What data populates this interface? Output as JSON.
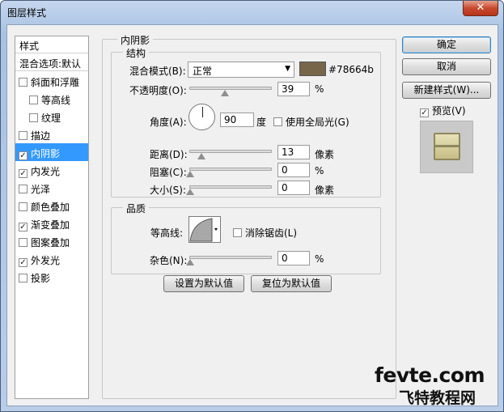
{
  "window": {
    "title": "图层样式",
    "close_label": "✕"
  },
  "styles_list": {
    "header": "样式",
    "blend_default": "混合选项:默认",
    "items": [
      {
        "label": "斜面和浮雕",
        "checked": false,
        "indent": false,
        "selected": false
      },
      {
        "label": "等高线",
        "checked": false,
        "indent": true,
        "selected": false
      },
      {
        "label": "纹理",
        "checked": false,
        "indent": true,
        "selected": false
      },
      {
        "label": "描边",
        "checked": false,
        "indent": false,
        "selected": false
      },
      {
        "label": "内阴影",
        "checked": true,
        "indent": false,
        "selected": true
      },
      {
        "label": "内发光",
        "checked": true,
        "indent": false,
        "selected": false
      },
      {
        "label": "光泽",
        "checked": false,
        "indent": false,
        "selected": false
      },
      {
        "label": "颜色叠加",
        "checked": false,
        "indent": false,
        "selected": false
      },
      {
        "label": "渐变叠加",
        "checked": true,
        "indent": false,
        "selected": false
      },
      {
        "label": "图案叠加",
        "checked": false,
        "indent": false,
        "selected": false
      },
      {
        "label": "外发光",
        "checked": true,
        "indent": false,
        "selected": false
      },
      {
        "label": "投影",
        "checked": false,
        "indent": false,
        "selected": false
      }
    ]
  },
  "panel": {
    "title": "内阴影",
    "structure": {
      "title": "结构",
      "blend_mode_label": "混合模式(B):",
      "blend_mode_value": "正常",
      "color_hex": "#78664b",
      "color": "#78664b",
      "opacity_label": "不透明度(O):",
      "opacity_value": "39",
      "opacity_unit": "%",
      "angle_label": "角度(A):",
      "angle_value": "90",
      "angle_unit": "度",
      "global_light_label": "使用全局光(G)",
      "global_light_checked": false,
      "distance_label": "距离(D):",
      "distance_value": "13",
      "distance_unit": "像素",
      "choke_label": "阻塞(C):",
      "choke_value": "0",
      "choke_unit": "%",
      "size_label": "大小(S):",
      "size_value": "0",
      "size_unit": "像素"
    },
    "quality": {
      "title": "品质",
      "contour_label": "等高线:",
      "antialias_label": "消除锯齿(L)",
      "antialias_checked": false,
      "noise_label": "杂色(N):",
      "noise_value": "0",
      "noise_unit": "%"
    },
    "make_default_label": "设置为默认值",
    "reset_default_label": "复位为默认值"
  },
  "buttons": {
    "ok": "确定",
    "cancel": "取消",
    "new_style": "新建样式(W)...",
    "preview_label": "预览(V)",
    "preview_checked": true
  },
  "watermark": {
    "line1": "fevte.com",
    "line2": "飞特教程网"
  }
}
